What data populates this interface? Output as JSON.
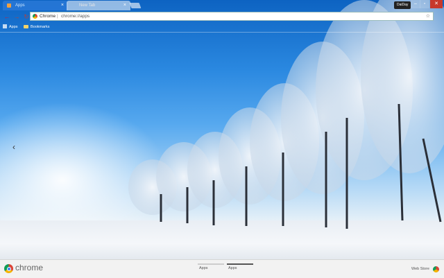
{
  "tabs": [
    {
      "label": "Apps",
      "active": true
    },
    {
      "label": "New Tab",
      "active": false
    }
  ],
  "user_badge": "DaiDay",
  "window_controls": {
    "minimize": "–",
    "maximize": "▫",
    "close": "✕"
  },
  "omnibox": {
    "chip": "Chrome",
    "separator": "|",
    "url": "chrome://apps"
  },
  "bookmarks": [
    {
      "label": "Apps",
      "icon": "apps-grid-icon"
    },
    {
      "label": "Bookmarks",
      "icon": "folder-icon"
    }
  ],
  "bottom": {
    "brand": "chrome",
    "pages": [
      "Apps",
      "Apps"
    ],
    "web_store": "Web Store"
  },
  "colors": {
    "accent": "#0d63c2",
    "close": "#c7382c"
  }
}
